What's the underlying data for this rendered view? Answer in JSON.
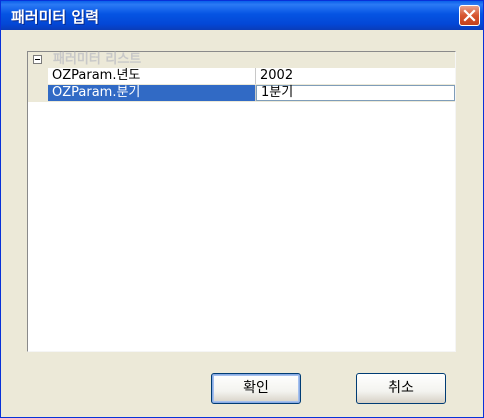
{
  "window": {
    "title": "패러미터 입력"
  },
  "group": {
    "label": "패러미터 리스트"
  },
  "params": [
    {
      "name": "OZParam.년도",
      "value": "2002"
    },
    {
      "name": "OZParam.분기",
      "value": "1분기"
    }
  ],
  "buttons": {
    "ok": "확인",
    "cancel": "취소"
  }
}
